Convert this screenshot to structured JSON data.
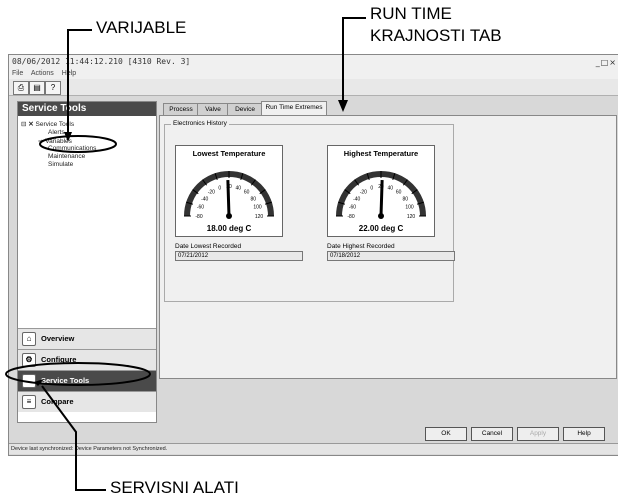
{
  "callouts": {
    "variables": "VARIJABLE",
    "runtime_line1": "RUN TIME",
    "runtime_line2": "KRAJNOSTI TAB",
    "service_tools": "SERVISNI ALATI"
  },
  "window": {
    "title": "08/06/2012 11:44:12.210 [4310 Rev. 3]",
    "controls": "_□×"
  },
  "menu": [
    "File",
    "Actions",
    "Help"
  ],
  "toolbar": {
    "print_icon": "printer-icon",
    "preview_icon": "print-preview-icon",
    "help_icon": "context-help-icon"
  },
  "left_panel": {
    "header": "Service Tools",
    "tree": {
      "root": "Service Tools",
      "items": [
        "Alerts",
        "Variables",
        "Communications",
        "Maintenance",
        "Simulate"
      ]
    },
    "nav": [
      {
        "label": "Overview",
        "icon": "overview-icon",
        "active": false
      },
      {
        "label": "Configure",
        "icon": "configure-icon",
        "active": false
      },
      {
        "label": "Service Tools",
        "icon": "service-tools-icon",
        "active": true
      },
      {
        "label": "Compare",
        "icon": "compare-icon",
        "active": false
      }
    ]
  },
  "tabs": [
    "Process",
    "Valve",
    "Device",
    "Run Time Extremes"
  ],
  "active_tab": "Run Time Extremes",
  "electronics_history": {
    "label": "Electronics History",
    "lowest": {
      "title": "Lowest Temperature",
      "value": 18.0,
      "display": "18.00 deg C",
      "scale_labels": [
        "-80",
        "-60",
        "-40",
        "-20",
        "0",
        "20",
        "40",
        "60",
        "80",
        "100",
        "120"
      ],
      "date_label": "Date Lowest Recorded",
      "date": "07/21/2012"
    },
    "highest": {
      "title": "Highest Temperature",
      "value": 22.0,
      "display": "22.00 deg C",
      "scale_labels": [
        "-80",
        "-60",
        "-40",
        "-20",
        "0",
        "20",
        "40",
        "60",
        "80",
        "100",
        "120"
      ],
      "date_label": "Date Highest Recorded",
      "date": "07/18/2012"
    }
  },
  "buttons": {
    "ok": "OK",
    "cancel": "Cancel",
    "apply": "Apply",
    "help": "Help"
  },
  "status": "Device last synchronized: Device Parameters not Synchronized."
}
